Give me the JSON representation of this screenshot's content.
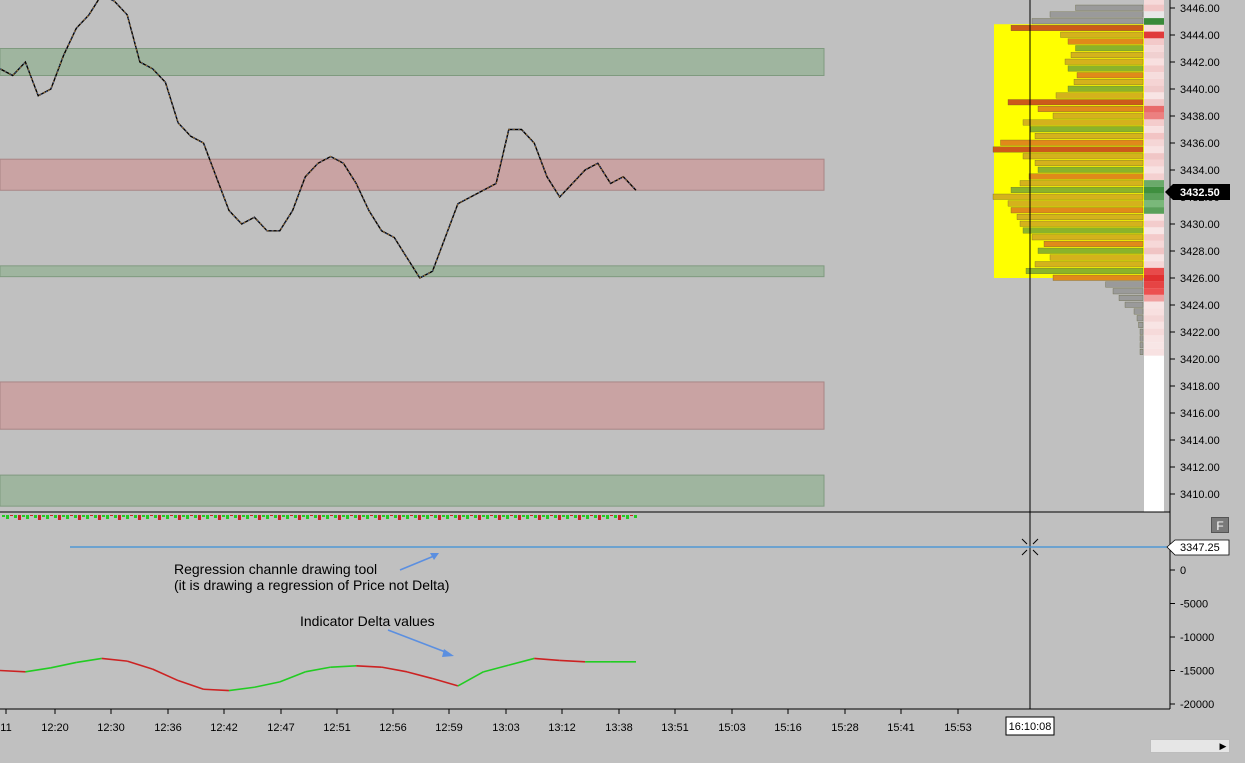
{
  "chart_data": {
    "type": "line",
    "price_panel": {
      "y_ticks": [
        3446,
        3444,
        3442,
        3440,
        3438,
        3436,
        3434,
        3432,
        3430,
        3428,
        3426,
        3424,
        3422,
        3420,
        3418,
        3416,
        3414,
        3412,
        3410
      ],
      "y_tick_labels": [
        "3446.00",
        "3444.00",
        "3442.00",
        "3440.00",
        "3438.00",
        "3436.00",
        "3434.00",
        "3432.00",
        "3430.00",
        "3428.00",
        "3426.00",
        "3424.00",
        "3422.00",
        "3420.00",
        "3418.00",
        "3416.00",
        "3414.00",
        "3412.00",
        "3410.00"
      ],
      "ylim": [
        3409,
        3447
      ],
      "current_price_label": "3432.50",
      "current_price": 3432.5,
      "price_series": [
        3441.5,
        3441.0,
        3442.0,
        3439.5,
        3440.0,
        3442.5,
        3444.5,
        3445.5,
        3447.0,
        3446.5,
        3445.5,
        3442.0,
        3441.5,
        3440.5,
        3437.5,
        3436.5,
        3436.0,
        3433.5,
        3431.0,
        3430.0,
        3430.5,
        3429.5,
        3429.5,
        3431.0,
        3433.5,
        3434.5,
        3435.0,
        3434.5,
        3433.0,
        3431.0,
        3429.5,
        3429.0,
        3427.5,
        3426.0,
        3426.5,
        3429.0,
        3431.5,
        3432.0,
        3432.5,
        3433.0,
        3437.0,
        3437.0,
        3436.0,
        3433.5,
        3432.0,
        3433.0,
        3434.0,
        3434.5,
        3433.0,
        3433.5,
        3432.5
      ],
      "zones": [
        {
          "type": "support",
          "from": 3441,
          "to": 3443
        },
        {
          "type": "resistance",
          "from": 3432.5,
          "to": 3434.8
        },
        {
          "type": "support",
          "from": 3426.1,
          "to": 3426.9
        },
        {
          "type": "resistance",
          "from": 3414.8,
          "to": 3418.3
        },
        {
          "type": "support",
          "from": 3409.1,
          "to": 3411.4
        }
      ],
      "value_area": {
        "from": 3426,
        "to": 3444.8
      },
      "volume_profile": [
        {
          "p": 3446,
          "v": 0.45
        },
        {
          "p": 3445.5,
          "v": 0.62
        },
        {
          "p": 3445,
          "v": 0.74
        },
        {
          "p": 3444.5,
          "v": 0.88
        },
        {
          "p": 3444,
          "v": 0.55
        },
        {
          "p": 3443.5,
          "v": 0.5
        },
        {
          "p": 3443,
          "v": 0.45
        },
        {
          "p": 3442.5,
          "v": 0.48
        },
        {
          "p": 3442,
          "v": 0.52
        },
        {
          "p": 3441.5,
          "v": 0.5
        },
        {
          "p": 3441,
          "v": 0.44
        },
        {
          "p": 3440.5,
          "v": 0.46
        },
        {
          "p": 3440,
          "v": 0.5
        },
        {
          "p": 3439.5,
          "v": 0.58
        },
        {
          "p": 3439,
          "v": 0.9
        },
        {
          "p": 3438.5,
          "v": 0.7
        },
        {
          "p": 3438,
          "v": 0.6
        },
        {
          "p": 3437.5,
          "v": 0.8
        },
        {
          "p": 3437,
          "v": 0.75
        },
        {
          "p": 3436.5,
          "v": 0.72
        },
        {
          "p": 3436,
          "v": 0.95
        },
        {
          "p": 3435.5,
          "v": 1.0
        },
        {
          "p": 3435,
          "v": 0.8
        },
        {
          "p": 3434.5,
          "v": 0.72
        },
        {
          "p": 3434,
          "v": 0.7
        },
        {
          "p": 3433.5,
          "v": 0.76
        },
        {
          "p": 3433,
          "v": 0.82
        },
        {
          "p": 3432.5,
          "v": 0.88
        },
        {
          "p": 3432,
          "v": 1.0
        },
        {
          "p": 3431.5,
          "v": 0.9
        },
        {
          "p": 3431,
          "v": 0.88
        },
        {
          "p": 3430.5,
          "v": 0.84
        },
        {
          "p": 3430,
          "v": 0.82
        },
        {
          "p": 3429.5,
          "v": 0.8
        },
        {
          "p": 3429,
          "v": 0.74
        },
        {
          "p": 3428.5,
          "v": 0.66
        },
        {
          "p": 3428,
          "v": 0.7
        },
        {
          "p": 3427.5,
          "v": 0.62
        },
        {
          "p": 3427,
          "v": 0.72
        },
        {
          "p": 3426.5,
          "v": 0.78
        },
        {
          "p": 3426,
          "v": 0.6
        },
        {
          "p": 3425.5,
          "v": 0.25
        },
        {
          "p": 3425,
          "v": 0.2
        },
        {
          "p": 3424.5,
          "v": 0.16
        },
        {
          "p": 3424,
          "v": 0.12
        },
        {
          "p": 3423.5,
          "v": 0.06
        },
        {
          "p": 3423,
          "v": 0.04
        },
        {
          "p": 3422.5,
          "v": 0.03
        },
        {
          "p": 3422,
          "v": 0.02
        },
        {
          "p": 3421.5,
          "v": 0.02
        },
        {
          "p": 3421,
          "v": 0.02
        },
        {
          "p": 3420.5,
          "v": 0.02
        }
      ]
    },
    "delta_panel": {
      "y_ticks": [
        0,
        -5000,
        -10000,
        -15000,
        -20000
      ],
      "y_tick_labels": [
        "0",
        "-5000",
        "-10000",
        "-15000",
        "-20000"
      ],
      "ylim": [
        -20500,
        3500
      ],
      "line_value_label": "3347.25",
      "line_value": 3347.25,
      "delta_series": [
        -15000,
        -15200,
        -14600,
        -13800,
        -13200,
        -13600,
        -14800,
        -16500,
        -17800,
        -18000,
        -17500,
        -16700,
        -15200,
        -14500,
        -14300,
        -14500,
        -15200,
        -16200,
        -17300,
        -15200,
        -14200,
        -13200,
        -13500,
        -13700,
        -13700,
        -13700
      ]
    },
    "x_tick_labels": [
      "11",
      "12:20",
      "12:30",
      "12:36",
      "12:42",
      "12:47",
      "12:51",
      "12:56",
      "12:59",
      "13:03",
      "13:12",
      "13:38",
      "13:51",
      "15:03",
      "15:16",
      "15:28",
      "15:41",
      "15:53"
    ],
    "crosshair_time_label": "16:10:08"
  },
  "annotations": {
    "regression_line1": "Regression channle drawing tool",
    "regression_line2": "(it is drawing a regression of Price not Delta)",
    "delta_label": "Indicator Delta values"
  },
  "buttons": {
    "panel_button": "F"
  },
  "colors": {
    "background": "#c0c0c0",
    "support_zone": "#9fb59f",
    "resistance_zone": "#c9a3a3",
    "value_area": "#ffff00",
    "price_label_bg": "#000000",
    "delta_up": "#22cc22",
    "delta_down": "#cc2222",
    "regression_line": "#3a8fd8"
  }
}
